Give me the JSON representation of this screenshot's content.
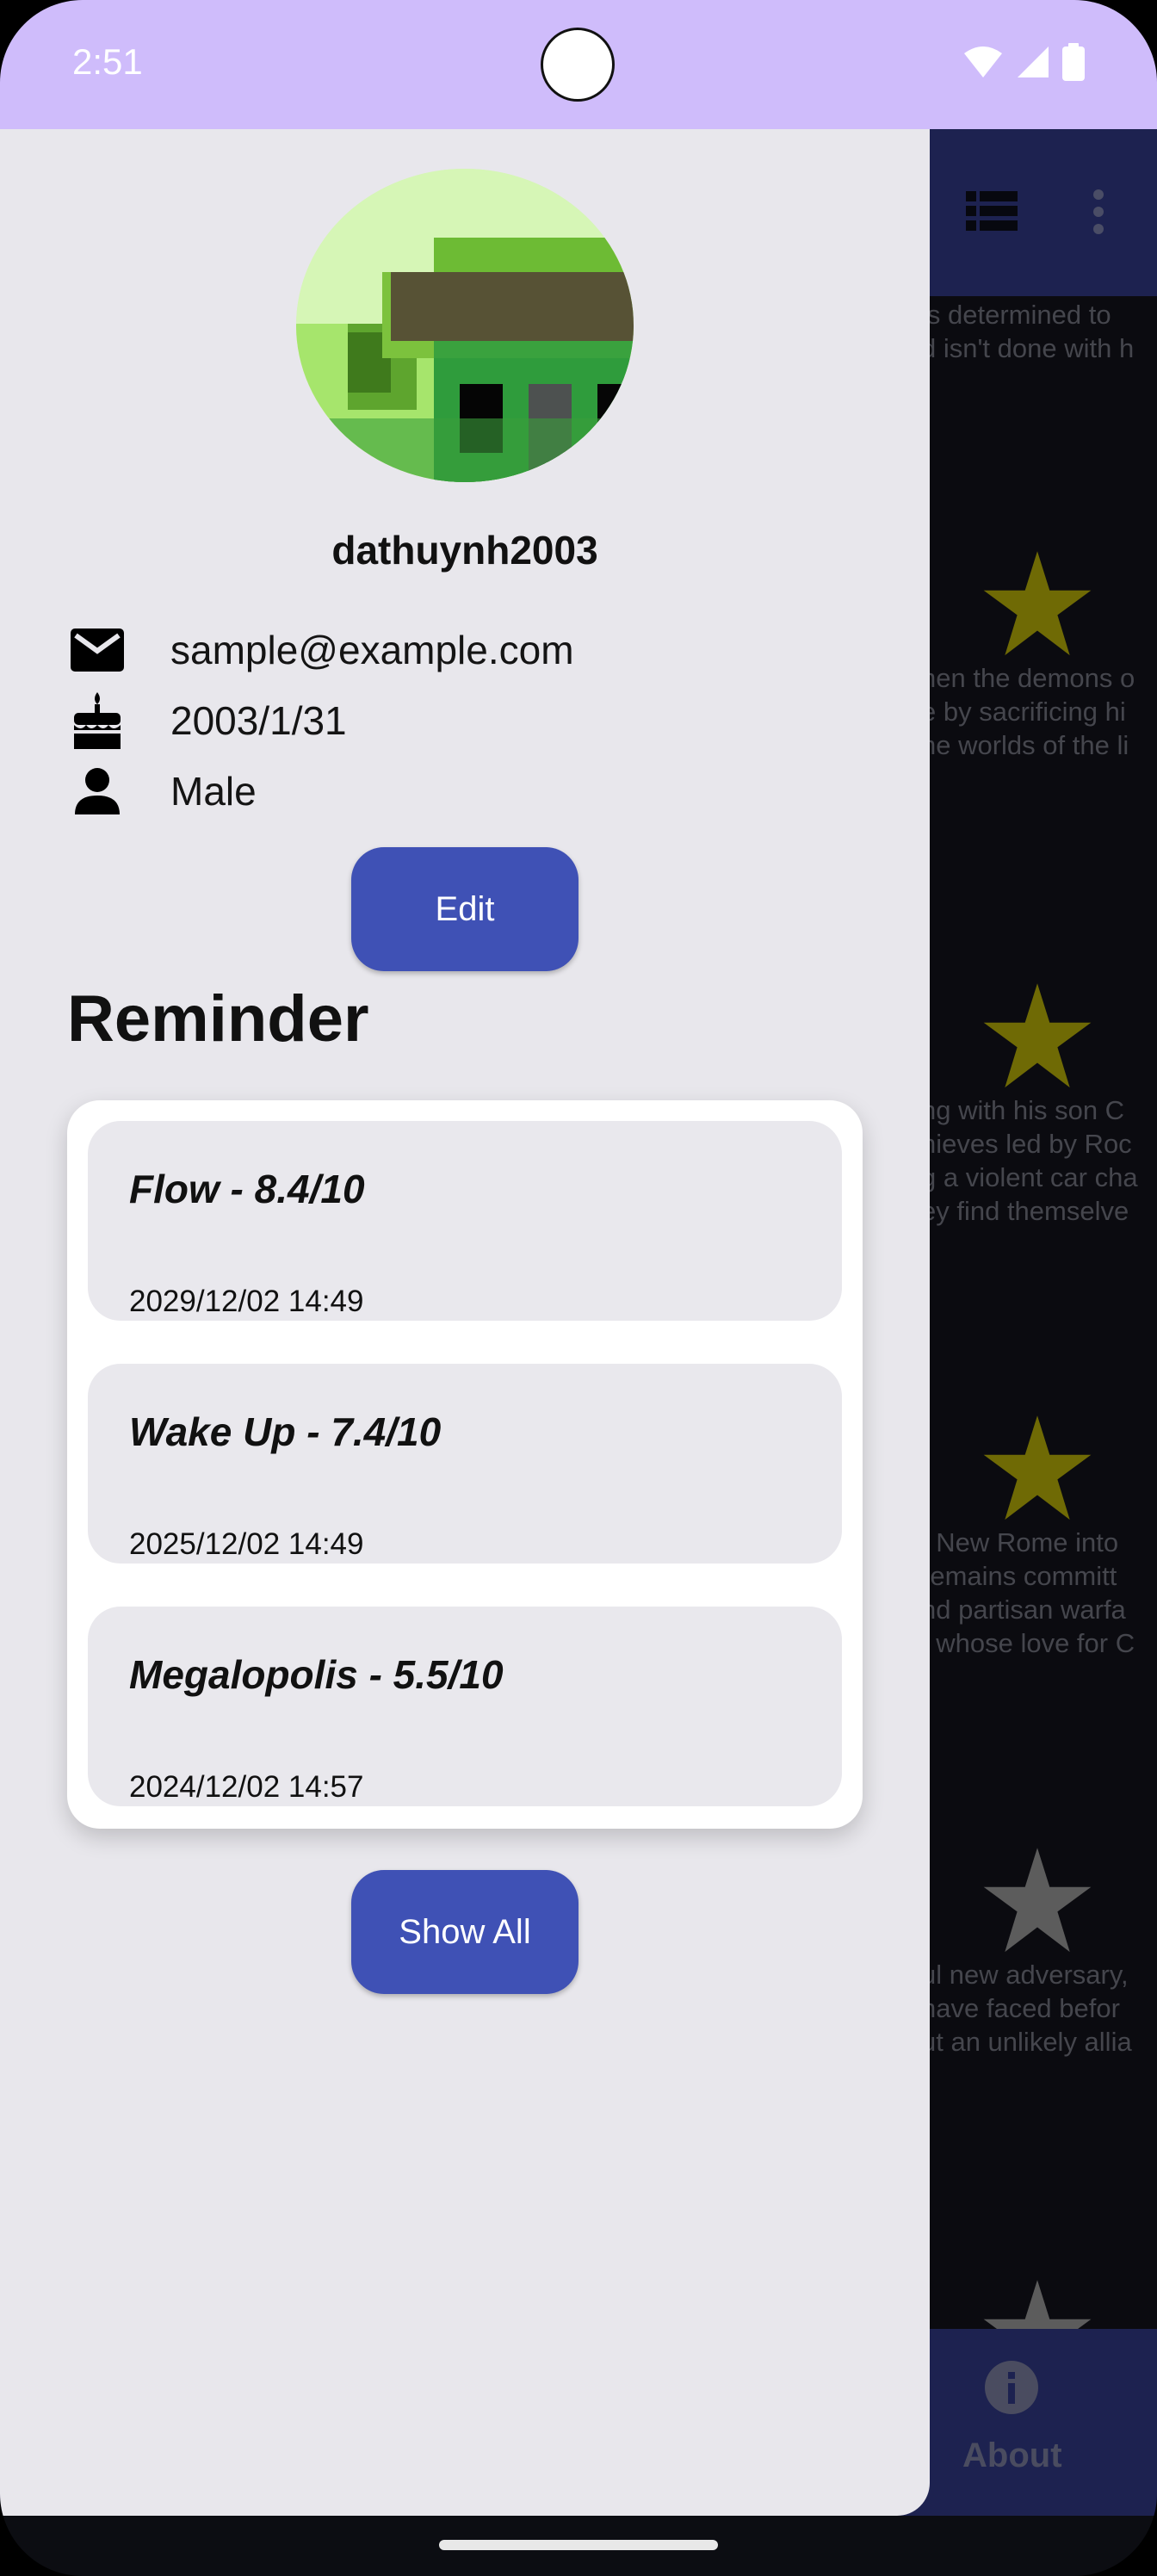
{
  "status_bar": {
    "time": "2:51",
    "icons": [
      "wifi-icon",
      "signal-icon",
      "battery-icon"
    ]
  },
  "background_app": {
    "top_icons": [
      "view-list-icon",
      "more-vert-icon"
    ],
    "text_snippets": [
      [
        " is determined to",
        "d isn't done with h"
      ],
      [
        "nen the demons o",
        "e by sacrificing hi",
        "he worlds of the li"
      ],
      [
        "ng with his son C",
        "hieves led by Roc",
        "g a violent car cha",
        "ey find themselve"
      ],
      [
        "f New Rome into",
        "remains committ",
        "nd partisan warfa",
        ", whose love for C"
      ],
      [
        "ul new adversary,",
        "have faced befor",
        "ut an unlikely allia"
      ]
    ],
    "bottom_nav": {
      "about_label": "About",
      "about_icon": "info-icon"
    }
  },
  "drawer": {
    "avatar_icon": "pixel-avatar-icon",
    "username": "dathuynh2003",
    "email": "sample@example.com",
    "birthday": "2003/1/31",
    "gender": "Male",
    "edit_label": "Edit",
    "reminder_heading": "Reminder",
    "reminders": [
      {
        "title": "Flow - 8.4/10",
        "date": "2029/12/02 14:49"
      },
      {
        "title": "Wake Up - 7.4/10",
        "date": "2025/12/02 14:49"
      },
      {
        "title": "Megalopolis - 5.5/10",
        "date": "2024/12/02 14:57"
      }
    ],
    "show_all_label": "Show All"
  },
  "colors": {
    "status_bar": "#cfbcfb",
    "drawer_bg": "#e8e7ec",
    "button": "#3f51b5",
    "app_bar": "#1d2250",
    "star_yellow": "#6f6a05",
    "star_gray": "#5c5c5c"
  }
}
